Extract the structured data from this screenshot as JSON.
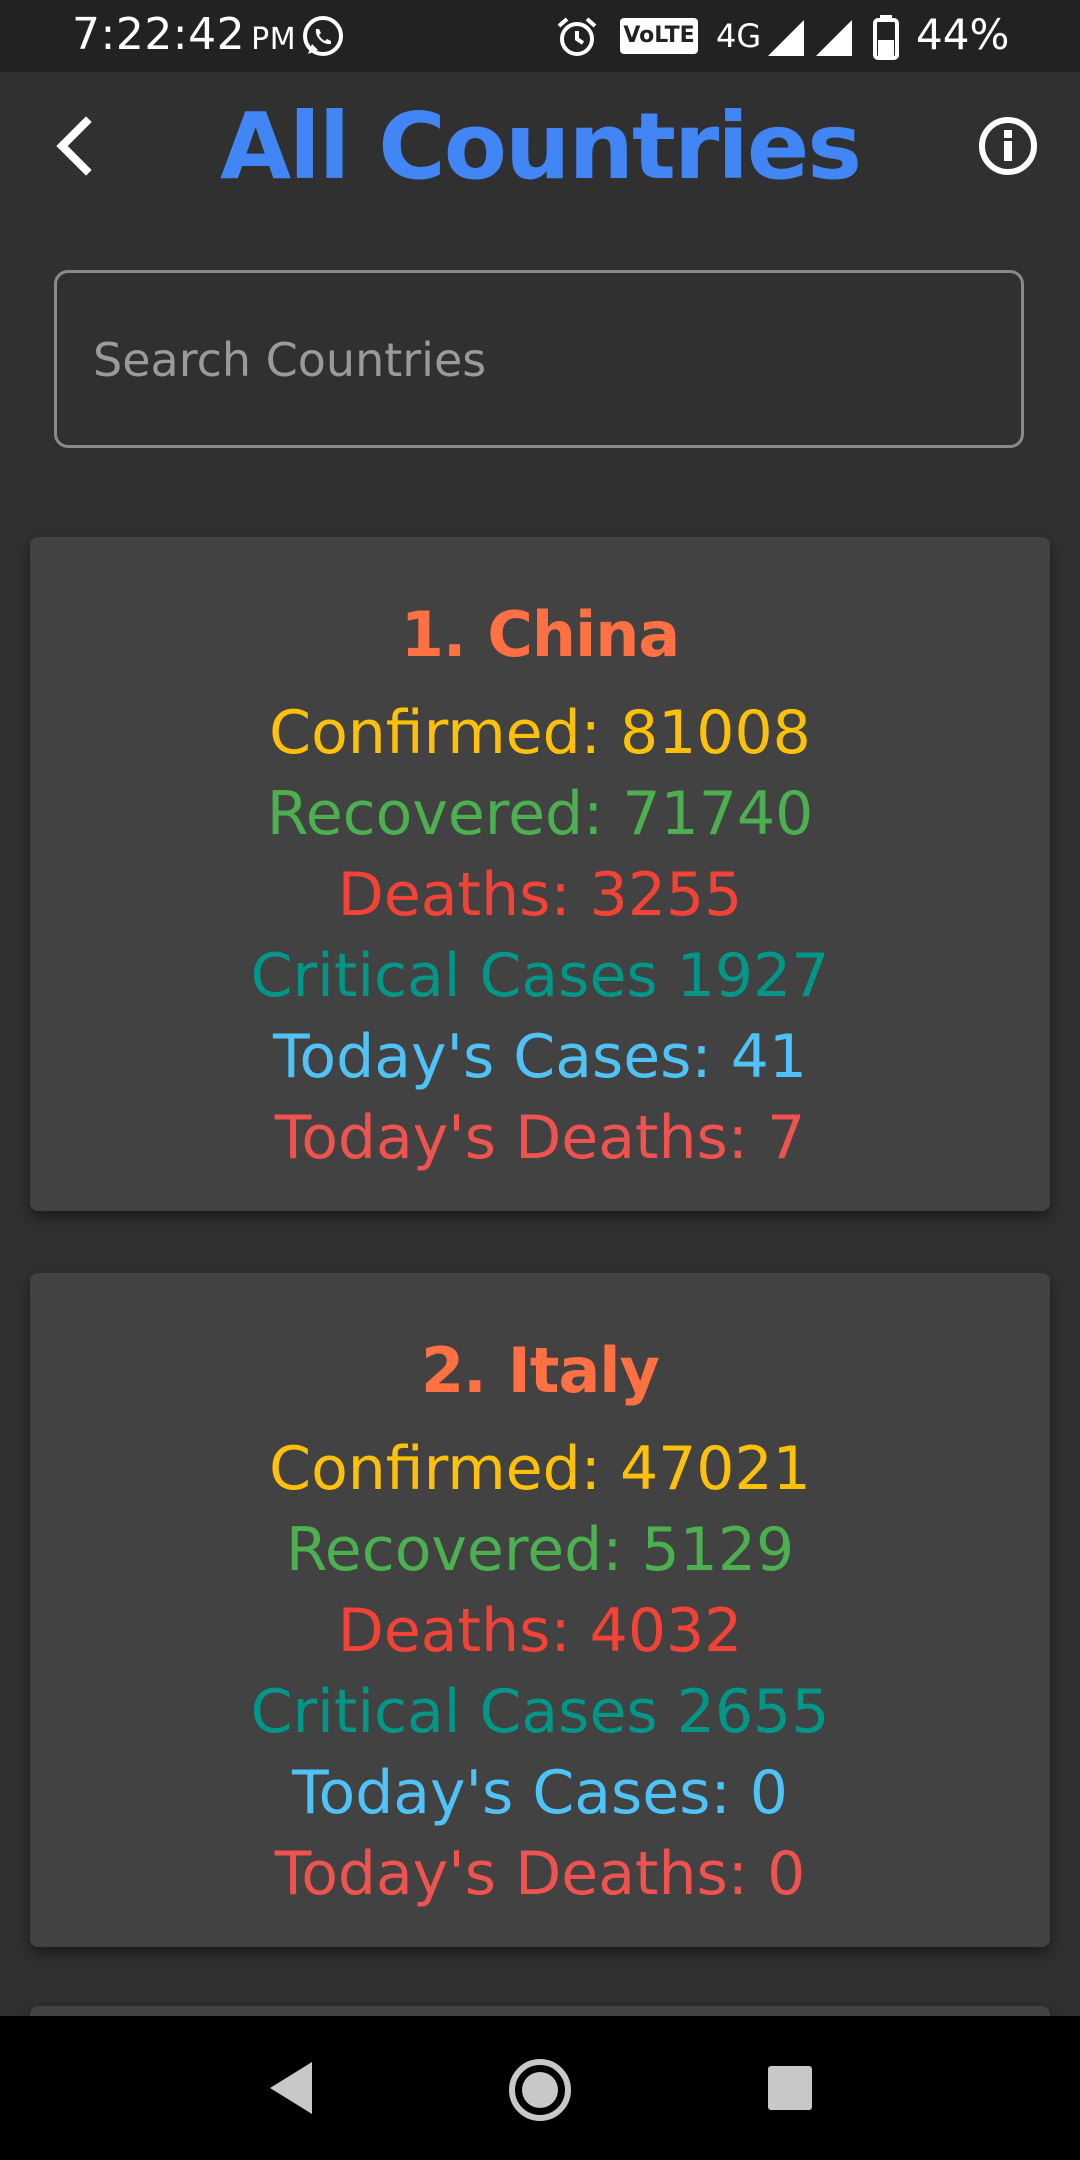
{
  "status_bar": {
    "time": "7:22:42",
    "ampm": "PM",
    "volte": "VoLTE",
    "network": "4G",
    "battery": "44%"
  },
  "header": {
    "title": "All Countries",
    "back_icon": "back-arrow-icon",
    "info_icon": "info-icon"
  },
  "search": {
    "placeholder": "Search Countries",
    "value": ""
  },
  "countries": [
    {
      "rank": "1.",
      "name": "China",
      "confirmed": "Confirmed: 81008",
      "recovered": "Recovered: 71740",
      "deaths": "Deaths: 3255",
      "critical": "Critical Cases 1927",
      "today_cases": "Today's Cases: 41",
      "today_deaths": "Today's Deaths: 7"
    },
    {
      "rank": "2.",
      "name": "Italy",
      "confirmed": "Confirmed: 47021",
      "recovered": "Recovered: 5129",
      "deaths": "Deaths: 4032",
      "critical": "Critical Cases 2655",
      "today_cases": "Today's Cases: 0",
      "today_deaths": "Today's Deaths: 0"
    }
  ],
  "colors": {
    "background": "#303030",
    "card": "#424242",
    "title": "#4285F4",
    "country_name": "#FF7043",
    "confirmed": "#FFC107",
    "recovered": "#4CAF50",
    "deaths": "#F44336",
    "critical": "#009688",
    "today_cases": "#4FC3F7",
    "today_deaths": "#EF5350"
  },
  "nav_bar": {
    "back_icon": "nav-back-icon",
    "home_icon": "nav-home-icon",
    "recents_icon": "nav-recents-icon"
  }
}
